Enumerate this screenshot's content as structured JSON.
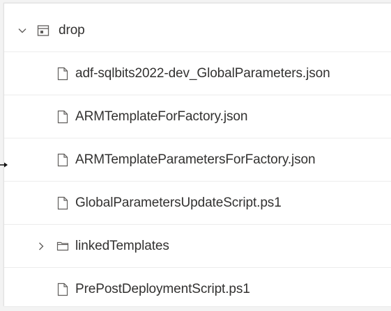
{
  "tree": {
    "root": {
      "label": "drop",
      "expanded": true,
      "chevron_icon": "chevron-down-icon",
      "icon": "artifact-drop-icon"
    },
    "items": [
      {
        "label": "adf-sqlbits2022-dev_GlobalParameters.json",
        "type": "file",
        "icon": "file-icon"
      },
      {
        "label": "ARMTemplateForFactory.json",
        "type": "file",
        "icon": "file-icon"
      },
      {
        "label": "ARMTemplateParametersForFactory.json",
        "type": "file",
        "icon": "file-icon"
      },
      {
        "label": "GlobalParametersUpdateScript.ps1",
        "type": "file",
        "icon": "file-icon"
      },
      {
        "label": "linkedTemplates",
        "type": "folder",
        "expanded": false,
        "chevron_icon": "chevron-right-icon",
        "icon": "folder-icon"
      },
      {
        "label": "PrePostDeploymentScript.ps1",
        "type": "file",
        "icon": "file-icon"
      }
    ]
  },
  "colors": {
    "text": "#323130",
    "icon": "#605e5c",
    "divider": "#ececec",
    "background": "#ffffff"
  }
}
